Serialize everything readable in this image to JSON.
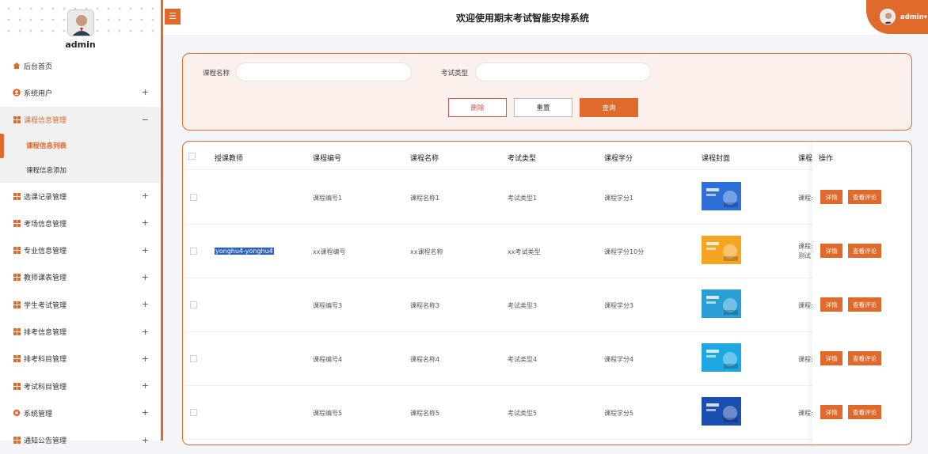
{
  "sidebar": {
    "username": "admin",
    "menu": [
      {
        "label": "后台首页",
        "icon": "home-icon",
        "expandable": false
      },
      {
        "label": "系统用户",
        "icon": "user-icon",
        "expandable": true
      },
      {
        "label": "课程信息管理",
        "icon": "grid-icon",
        "expandable": true,
        "open": true,
        "children": [
          {
            "label": "课程信息列表",
            "active": true
          },
          {
            "label": "课程信息添加",
            "active": false
          }
        ]
      },
      {
        "label": "选课记录管理",
        "icon": "grid-icon",
        "expandable": true
      },
      {
        "label": "考场信息管理",
        "icon": "grid-icon",
        "expandable": true
      },
      {
        "label": "专业信息管理",
        "icon": "grid-icon",
        "expandable": true
      },
      {
        "label": "教师课表管理",
        "icon": "grid-icon",
        "expandable": true
      },
      {
        "label": "学生考试管理",
        "icon": "grid-icon",
        "expandable": true
      },
      {
        "label": "排考信息管理",
        "icon": "grid-icon",
        "expandable": true
      },
      {
        "label": "排考科目管理",
        "icon": "grid-icon",
        "expandable": true
      },
      {
        "label": "考试科目管理",
        "icon": "grid-icon",
        "expandable": true
      },
      {
        "label": "系统管理",
        "icon": "gear-icon",
        "expandable": true
      },
      {
        "label": "通知公告管理",
        "icon": "grid-icon",
        "expandable": true
      }
    ],
    "expand_symbol": "+",
    "collapse_symbol": "−"
  },
  "header": {
    "menu_button": "☰",
    "title": "欢迎使用期末考试智能安排系统",
    "user": "admin",
    "user_caret": "▾"
  },
  "search": {
    "course_name_label": "课程名称",
    "course_name_value": "",
    "exam_type_label": "考试类型",
    "exam_type_value": "",
    "delete_label": "删除",
    "reset_label": "重置",
    "query_label": "查询"
  },
  "table": {
    "columns": [
      "授课教师",
      "课程编号",
      "课程名称",
      "考试类型",
      "课程学分",
      "课程封面",
      "课程",
      "操作"
    ],
    "detail_label": "详情",
    "review_label": "查看评论",
    "rows": [
      {
        "teacher": "",
        "code": "课程编号1",
        "name": "课程名称1",
        "type": "考试类型1",
        "credit": "课程学分1",
        "cover_color": "#2f6fd8",
        "extra": "课程:",
        "extra2": ""
      },
      {
        "teacher": "yonghu4-yonghu4",
        "code": "xx课程编号",
        "name": "xx课程名称",
        "type": "xx考试类型",
        "credit": "课程学分10分",
        "cover_color": "#f4a524",
        "extra": "课程:",
        "extra2": "测试"
      },
      {
        "teacher": "",
        "code": "课程编号3",
        "name": "课程名称3",
        "type": "考试类型3",
        "credit": "课程学分3",
        "cover_color": "#2a9fd6",
        "extra": "课程:",
        "extra2": ""
      },
      {
        "teacher": "",
        "code": "课程编号4",
        "name": "课程名称4",
        "type": "考试类型4",
        "credit": "课程学分4",
        "cover_color": "#1ea7e0",
        "extra": "课程:",
        "extra2": ""
      },
      {
        "teacher": "",
        "code": "课程编号5",
        "name": "课程名称5",
        "type": "考试类型5",
        "credit": "课程学分5",
        "cover_color": "#1b4fb0",
        "extra": "课程:",
        "extra2": ""
      }
    ]
  }
}
